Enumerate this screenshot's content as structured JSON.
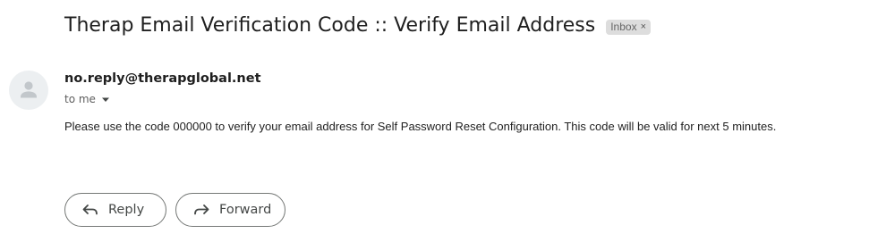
{
  "email": {
    "subject": "Therap Email Verification Code :: Verify Email Address",
    "label": {
      "text": "Inbox",
      "close_glyph": "×"
    },
    "sender": "no.reply@therapglobal.net",
    "recipient_text": "to me",
    "body": "Please use the code 000000 to verify your email address for Self Password Reset Configuration. This code will be valid for next 5 minutes."
  },
  "actions": {
    "reply_label": "Reply",
    "forward_label": "Forward"
  },
  "icons": {
    "avatar": "person-icon",
    "recipient_details": "caret-down-icon",
    "reply": "reply-arrow-icon",
    "forward": "forward-arrow-icon"
  },
  "colors": {
    "text_primary": "#1f1f1f",
    "text_secondary": "#5e5e5e",
    "chip_background": "#dddddd",
    "avatar_background": "#eceff1",
    "button_border": "#747775"
  }
}
